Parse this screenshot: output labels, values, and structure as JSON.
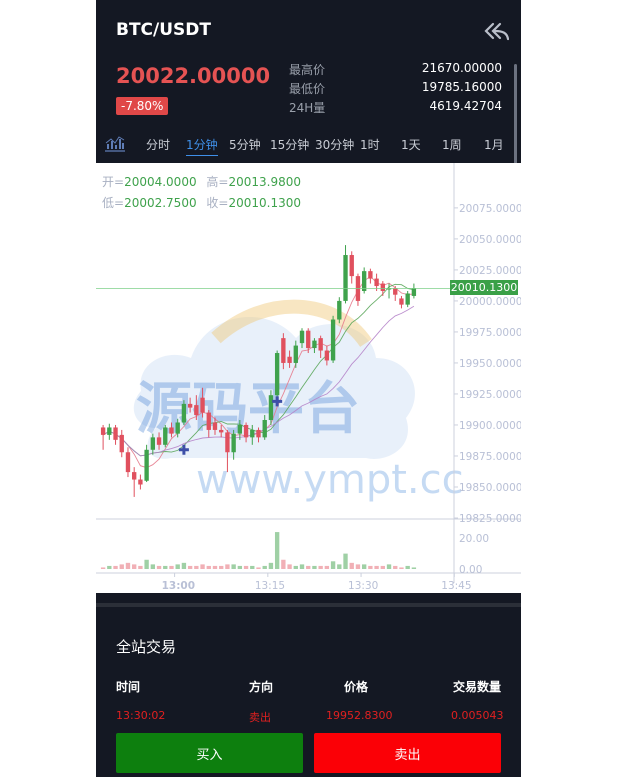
{
  "header": {
    "pair": "BTC/USDT",
    "back_icon": "back-double-arrow-icon",
    "price": "20022.00000",
    "change": "-7.80%",
    "stats": [
      {
        "label": "最高价",
        "value": "21670.00000"
      },
      {
        "label": "最低价",
        "value": "19785.16000"
      },
      {
        "label": "24H量",
        "value": "4619.42704"
      }
    ]
  },
  "tabs": {
    "icon": "kline-bars-icon",
    "items": [
      "分时",
      "1分钟",
      "5分钟",
      "15分钟",
      "30分钟",
      "1时",
      "1天",
      "1周",
      "1月"
    ],
    "active": "1分钟"
  },
  "ohlc": {
    "open_label": "开=",
    "open": "20004.0000",
    "high_label": "高=",
    "high": "20013.9800",
    "low_label": "低=",
    "low": "20002.7500",
    "close_label": "收=",
    "close": "20010.1300"
  },
  "watermark": {
    "cn": "源码平台",
    "url": "www.ympt.cc"
  },
  "chart_data": {
    "type": "candlestick",
    "price_ticks": [
      "20075.0000",
      "20050.0000",
      "20025.0000",
      "20000.0000",
      "19975.0000",
      "19950.0000",
      "19925.0000",
      "19900.0000",
      "19875.0000",
      "19850.0000",
      "19825.0000"
    ],
    "price_tick_values": [
      20075,
      20050,
      20025,
      20000,
      19975,
      19950,
      19925,
      19900,
      19875,
      19850,
      19825
    ],
    "ylim": [
      19825,
      20087
    ],
    "last_price": "20010.1300",
    "last_price_value": 20010.13,
    "volume_ticks": [
      "20.00",
      "0.00"
    ],
    "volume_tick_values": [
      20,
      0
    ],
    "volume_ylim": [
      0,
      26
    ],
    "time_ticks": [
      "13:00",
      "13:15",
      "13:30",
      "13:45"
    ],
    "candles": [
      {
        "o": 19898,
        "c": 19892,
        "h": 19900,
        "l": 19880,
        "v": 1
      },
      {
        "o": 19892,
        "c": 19898,
        "h": 19901,
        "l": 19888,
        "v": 2
      },
      {
        "o": 19898,
        "c": 19888,
        "h": 19900,
        "l": 19884,
        "v": 2
      },
      {
        "o": 19892,
        "c": 19878,
        "h": 19896,
        "l": 19874,
        "v": 3
      },
      {
        "o": 19878,
        "c": 19862,
        "h": 19882,
        "l": 19858,
        "v": 4
      },
      {
        "o": 19862,
        "c": 19856,
        "h": 19866,
        "l": 19842,
        "v": 3
      },
      {
        "o": 19856,
        "c": 19852,
        "h": 19860,
        "l": 19848,
        "v": 2
      },
      {
        "o": 19855,
        "c": 19880,
        "h": 19884,
        "l": 19854,
        "v": 6
      },
      {
        "o": 19880,
        "c": 19890,
        "h": 19893,
        "l": 19876,
        "v": 3
      },
      {
        "o": 19890,
        "c": 19884,
        "h": 19894,
        "l": 19880,
        "v": 2
      },
      {
        "o": 19884,
        "c": 19898,
        "h": 19900,
        "l": 19882,
        "v": 2
      },
      {
        "o": 19898,
        "c": 19893,
        "h": 19902,
        "l": 19890,
        "v": 2
      },
      {
        "o": 19893,
        "c": 19902,
        "h": 19905,
        "l": 19890,
        "v": 3
      },
      {
        "o": 19902,
        "c": 19917,
        "h": 19920,
        "l": 19900,
        "v": 4
      },
      {
        "o": 19917,
        "c": 19914,
        "h": 19922,
        "l": 19910,
        "v": 2
      },
      {
        "o": 19916,
        "c": 19908,
        "h": 19924,
        "l": 19904,
        "v": 2
      },
      {
        "o": 19922,
        "c": 19910,
        "h": 19930,
        "l": 19906,
        "v": 3
      },
      {
        "o": 19910,
        "c": 19896,
        "h": 19912,
        "l": 19890,
        "v": 2
      },
      {
        "o": 19902,
        "c": 19896,
        "h": 19906,
        "l": 19892,
        "v": 2
      },
      {
        "o": 19896,
        "c": 19894,
        "h": 19900,
        "l": 19890,
        "v": 2
      },
      {
        "o": 19894,
        "c": 19878,
        "h": 19896,
        "l": 19862,
        "v": 3
      },
      {
        "o": 19878,
        "c": 19893,
        "h": 19896,
        "l": 19872,
        "v": 3
      },
      {
        "o": 19893,
        "c": 19900,
        "h": 19904,
        "l": 19888,
        "v": 2
      },
      {
        "o": 19900,
        "c": 19890,
        "h": 19902,
        "l": 19886,
        "v": 2
      },
      {
        "o": 19890,
        "c": 19896,
        "h": 19900,
        "l": 19884,
        "v": 2
      },
      {
        "o": 19896,
        "c": 19890,
        "h": 19898,
        "l": 19886,
        "v": 1
      },
      {
        "o": 19890,
        "c": 19904,
        "h": 19908,
        "l": 19888,
        "v": 2
      },
      {
        "o": 19904,
        "c": 19924,
        "h": 19928,
        "l": 19900,
        "v": 4
      },
      {
        "o": 19924,
        "c": 19958,
        "h": 19960,
        "l": 19922,
        "v": 24
      },
      {
        "o": 19970,
        "c": 19950,
        "h": 19974,
        "l": 19945,
        "v": 6
      },
      {
        "o": 19955,
        "c": 19950,
        "h": 19960,
        "l": 19946,
        "v": 3
      },
      {
        "o": 19950,
        "c": 19964,
        "h": 19968,
        "l": 19946,
        "v": 2
      },
      {
        "o": 19966,
        "c": 19976,
        "h": 19978,
        "l": 19962,
        "v": 3
      },
      {
        "o": 19976,
        "c": 19962,
        "h": 19978,
        "l": 19958,
        "v": 2
      },
      {
        "o": 19962,
        "c": 19968,
        "h": 19970,
        "l": 19958,
        "v": 2
      },
      {
        "o": 19970,
        "c": 19960,
        "h": 19972,
        "l": 19954,
        "v": 2
      },
      {
        "o": 19960,
        "c": 19952,
        "h": 19964,
        "l": 19948,
        "v": 2
      },
      {
        "o": 19952,
        "c": 19985,
        "h": 19988,
        "l": 19950,
        "v": 5
      },
      {
        "o": 19985,
        "c": 20000,
        "h": 20003,
        "l": 19982,
        "v": 3
      },
      {
        "o": 20000,
        "c": 20037,
        "h": 20045,
        "l": 19998,
        "v": 10
      },
      {
        "o": 20037,
        "c": 20020,
        "h": 20040,
        "l": 20014,
        "v": 4
      },
      {
        "o": 20020,
        "c": 20000,
        "h": 20022,
        "l": 19996,
        "v": 3
      },
      {
        "o": 20008,
        "c": 20024,
        "h": 20027,
        "l": 20006,
        "v": 3
      },
      {
        "o": 20024,
        "c": 20018,
        "h": 20026,
        "l": 20014,
        "v": 2
      },
      {
        "o": 20018,
        "c": 20012,
        "h": 20022,
        "l": 20008,
        "v": 2
      },
      {
        "o": 20014,
        "c": 20008,
        "h": 20016,
        "l": 20004,
        "v": 2
      },
      {
        "o": 20010,
        "c": 20010,
        "h": 20014,
        "l": 20002,
        "v": 3
      },
      {
        "o": 20010,
        "c": 20005,
        "h": 20012,
        "l": 20000,
        "v": 2
      },
      {
        "o": 20002,
        "c": 19997,
        "h": 20004,
        "l": 19994,
        "v": 1
      },
      {
        "o": 19997,
        "c": 20006,
        "h": 20008,
        "l": 19995,
        "v": 2
      },
      {
        "o": 20004,
        "c": 20010,
        "h": 20014,
        "l": 20002,
        "v": 1
      }
    ],
    "ma_series": [
      {
        "color": "#e57a8c"
      },
      {
        "color": "#5aa65a"
      },
      {
        "color": "#b583c9"
      }
    ]
  },
  "trades": {
    "title": "全站交易",
    "headers": [
      "时间",
      "方向",
      "价格",
      "交易数量"
    ],
    "rows": [
      {
        "time": "13:30:02",
        "side": "卖出",
        "price": "19952.8300",
        "qty": "0.005043"
      }
    ]
  },
  "actions": {
    "buy": "买入",
    "sell": "卖出"
  },
  "colors": {
    "up": "#3fa24c",
    "down": "#e0505e",
    "bg": "#141823",
    "accent": "#3f8fe8",
    "buy": "#0d7f0e",
    "sell": "#fb0006"
  }
}
